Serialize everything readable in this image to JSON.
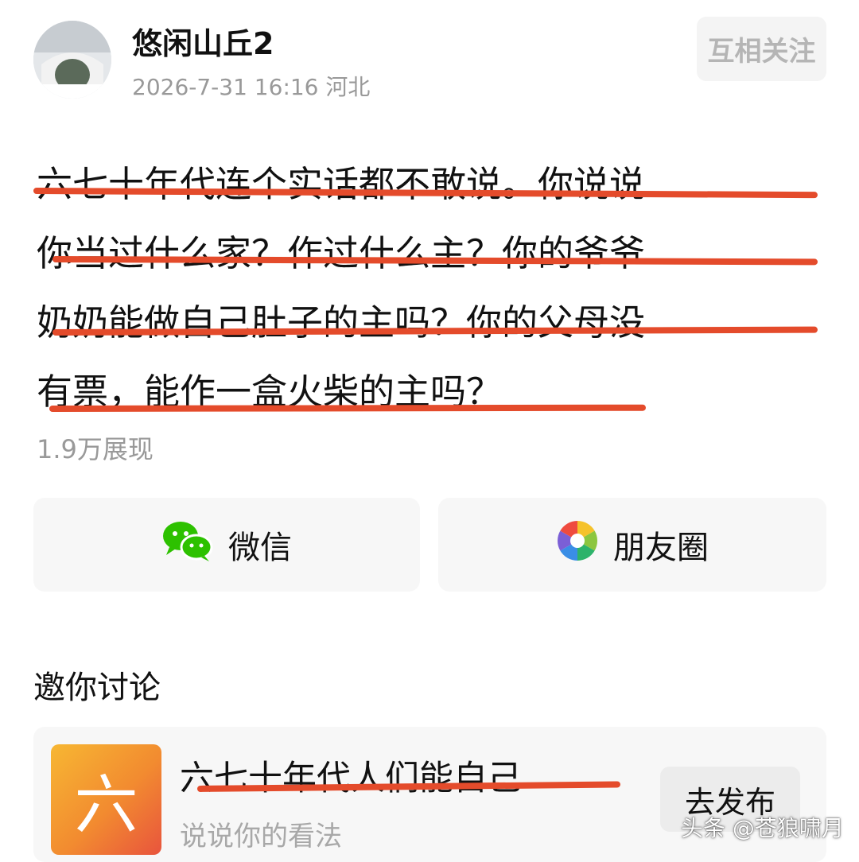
{
  "author": {
    "name": "悠闲山丘2",
    "date": "2026-7-31 16:16",
    "location": "河北",
    "follow_label": "互相关注"
  },
  "post": {
    "lines": [
      "六七十年代连个实话都不敢说。你说说",
      "你当过什么家？作过什么主？你的爷爷",
      "奶奶能做自己肚子的主吗？你的父母没",
      "有票，能作一盒火柴的主吗？"
    ],
    "views": "1.9万展现"
  },
  "share": {
    "wechat_label": "微信",
    "moments_label": "朋友圈"
  },
  "discussion": {
    "title": "邀你讨论",
    "topic_thumb_char": "六",
    "topic_title": "六七十年代人们能自己",
    "topic_placeholder": "说说你的看法",
    "publish_label": "去发布"
  },
  "watermark": "头条 @苍狼啸月",
  "colors": {
    "underline": "#e44b2b",
    "wechat_green": "#2dc100"
  }
}
